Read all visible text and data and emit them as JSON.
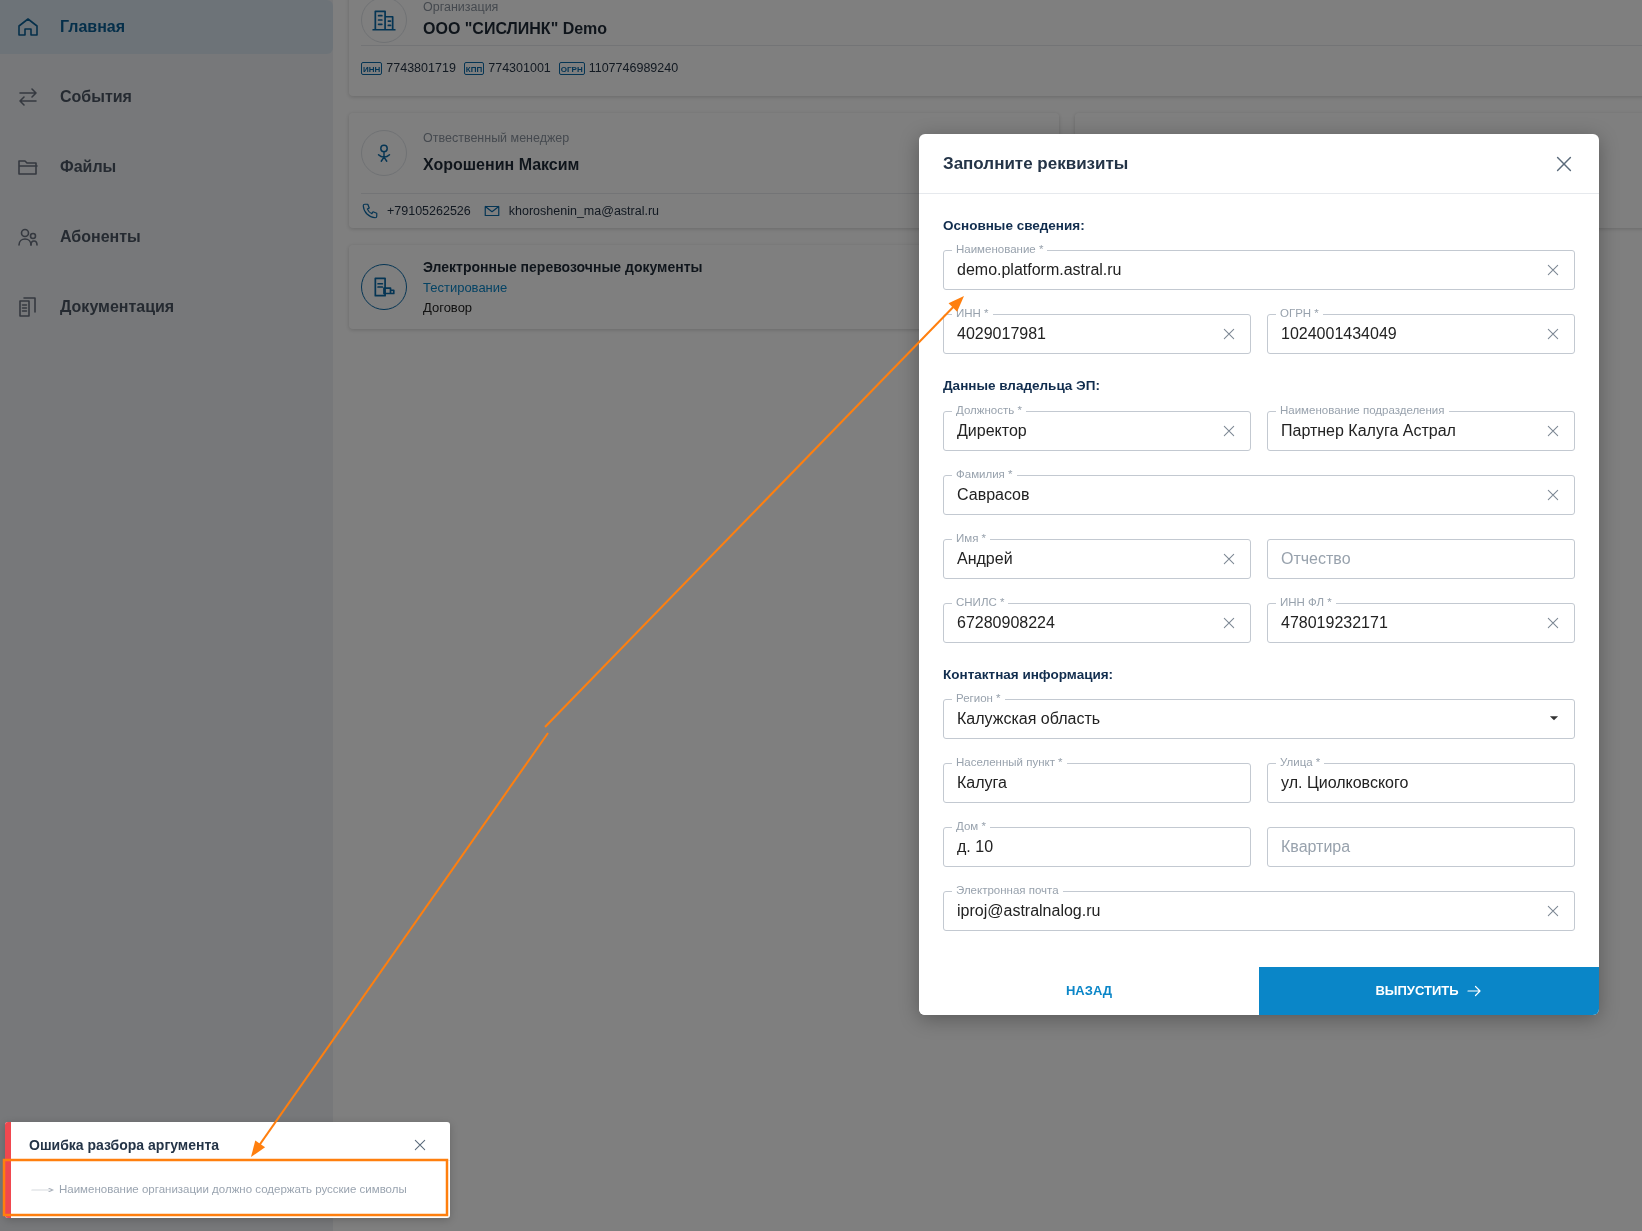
{
  "sidebar": {
    "items": [
      {
        "label": "Главная",
        "selected": true
      },
      {
        "label": "События",
        "selected": false
      },
      {
        "label": "Файлы",
        "selected": false
      },
      {
        "label": "Абоненты",
        "selected": false
      },
      {
        "label": "Документация",
        "selected": false
      }
    ]
  },
  "organization_card": {
    "label": "Организация",
    "name": "ООО \"СИСЛИНК\" Demo",
    "codes": [
      {
        "tag": "ИНН",
        "value": "7743801719"
      },
      {
        "tag": "КПП",
        "value": "774301001"
      },
      {
        "tag": "ОГРН",
        "value": "1107746989240"
      }
    ]
  },
  "manager_card": {
    "label": "Отвественный менеджер",
    "name": "Хорошенин Максим",
    "phone": "+79105262526",
    "email": "khoroshenin_ma@astral.ru"
  },
  "service_card": {
    "title": "Электронные перевозочные документы",
    "subtitle": "Тестирование",
    "text": "Договор"
  },
  "modal": {
    "title": "Заполните реквизиты",
    "sections": [
      {
        "title": "Основные сведения:",
        "rows": [
          [
            {
              "kind": "text",
              "label": "Наименование *",
              "value": "demo.platform.astral.ru",
              "clearable": true
            }
          ],
          [
            {
              "kind": "text",
              "label": "ИНН *",
              "value": "4029017981",
              "clearable": true
            },
            {
              "kind": "text",
              "label": "ОГРН *",
              "value": "1024001434049",
              "clearable": true
            }
          ]
        ]
      },
      {
        "title": "Данные владельца ЭП:",
        "rows": [
          [
            {
              "kind": "text",
              "label": "Должность *",
              "value": "Директор",
              "clearable": true
            },
            {
              "kind": "text",
              "label": "Наименование подразделения",
              "value": "Партнер Калуга Астрал",
              "clearable": true
            }
          ],
          [
            {
              "kind": "text",
              "label": "Фамилия *",
              "value": "Саврасов",
              "clearable": true
            }
          ],
          [
            {
              "kind": "text",
              "label": "Имя *",
              "value": "Андрей",
              "clearable": true
            },
            {
              "kind": "text",
              "placeholder": "Отчество",
              "clearable": false
            }
          ],
          [
            {
              "kind": "text",
              "label": "СНИЛС *",
              "value": "67280908224",
              "clearable": true
            },
            {
              "kind": "text",
              "label": "ИНН ФЛ *",
              "value": "478019232171",
              "clearable": true
            }
          ]
        ]
      },
      {
        "title": "Контактная информация:",
        "rows": [
          [
            {
              "kind": "select",
              "label": "Регион *",
              "value": "Калужская область",
              "clearable": false
            }
          ],
          [
            {
              "kind": "text",
              "label": "Населенный пункт *",
              "value": "Калуга",
              "clearable": false
            },
            {
              "kind": "text",
              "label": "Улица *",
              "value": "ул. Циолковского",
              "clearable": false
            }
          ],
          [
            {
              "kind": "text",
              "label": "Дом *",
              "value": "д. 10",
              "clearable": false
            },
            {
              "kind": "text",
              "placeholder": "Квартира",
              "clearable": false
            }
          ],
          [
            {
              "kind": "text",
              "label": "Электронная почта",
              "value": "iproj@astralnalog.ru",
              "clearable": true
            }
          ]
        ]
      }
    ],
    "back_button": "НАЗАД",
    "submit_button": "ВЫПУСТИТЬ"
  },
  "toast": {
    "error": true,
    "title": "Ошибка разбора аргумента",
    "message": "Наименование организации должно содержать русские символы"
  },
  "annotations": [
    {
      "kind": "arrow"
    },
    {
      "kind": "arrow"
    },
    {
      "kind": "frame"
    }
  ]
}
